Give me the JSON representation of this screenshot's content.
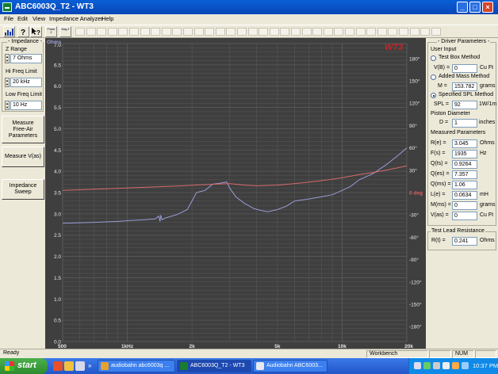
{
  "window": {
    "title": "ABC6003Q_T2 - WT3",
    "btn_minimize": "_",
    "btn_maximize": "□",
    "btn_close": "×"
  },
  "menu": [
    "File",
    "Edit",
    "View",
    "Impedance Analyzer",
    "Help"
  ],
  "toolbar": {
    "icons": [
      "chart-icon",
      "help-icon",
      "context-help-icon"
    ],
    "view_buttons": [
      {
        "label": "Phase Z"
      },
      {
        "label": "Mag Z"
      }
    ]
  },
  "left_panel": {
    "impedance_group_title": "Impedance",
    "z_range_label": "Z Range",
    "z_range_value": "7 Ohms",
    "hi_freq_label": "Hi Freq Limit",
    "hi_freq_value": "20 kHz",
    "low_freq_label": "Low Freq Limit",
    "low_freq_value": "10 Hz",
    "measure_free_air_lines": [
      "Measure",
      "Free-Air",
      "Parameters"
    ],
    "measure_vas_label": "Measure V(as)",
    "impedance_sweep_lines": [
      "Impedance",
      "Sweep"
    ]
  },
  "graph": {
    "logo": "WT3",
    "left_unit": "Ohms",
    "left_axis_ticks": [
      "7.0",
      "6.5",
      "6.0",
      "5.5",
      "5.0",
      "4.5",
      "4.0",
      "3.5",
      "3.0",
      "2.5",
      "2.0",
      "1.5",
      "1.0",
      "0.5",
      "0.0"
    ],
    "right_axis_ticks": [
      "180°",
      "150°",
      "120°",
      "90°",
      "60°",
      "30°",
      "0 deg",
      "-30°",
      "-60°",
      "-90°",
      "-120°",
      "-150°",
      "-180°"
    ],
    "x_axis_ticks": [
      "500",
      "1kHz",
      "2k",
      "5k",
      "10k",
      "20k"
    ],
    "colors": {
      "background": "#3f3f3f",
      "grid": "#5a5a5a",
      "impedance": "#9a9cd8",
      "phase": "#d86a6a"
    }
  },
  "chart_data": {
    "type": "line",
    "x_scale": "log",
    "xlim": [
      500,
      20000
    ],
    "ylim": [
      0,
      7
    ],
    "y2lim": [
      -200,
      200
    ],
    "series": [
      {
        "name": "impedance",
        "axis": "left",
        "x": [
          500,
          700,
          900,
          1000,
          1200,
          1350,
          1400,
          1420,
          1430,
          1450,
          1500,
          1700,
          1900,
          2000,
          2100,
          2300,
          2500,
          2700,
          2900,
          3000,
          3200,
          3500,
          3900,
          4200,
          4500,
          5000,
          5500,
          6000,
          7000,
          8000,
          9000,
          10000,
          11000,
          12000,
          14000,
          16000,
          18000,
          20000
        ],
        "y": [
          2.78,
          2.8,
          2.82,
          2.84,
          2.86,
          2.88,
          2.95,
          2.82,
          2.97,
          2.86,
          2.9,
          2.98,
          3.1,
          3.3,
          3.5,
          3.55,
          3.7,
          3.72,
          3.75,
          3.6,
          3.4,
          3.25,
          3.12,
          3.08,
          3.05,
          3.1,
          3.18,
          3.3,
          3.35,
          3.4,
          3.45,
          3.55,
          3.65,
          3.8,
          3.95,
          4.15,
          4.35,
          4.55
        ]
      },
      {
        "name": "phase",
        "axis": "right",
        "x": [
          500,
          800,
          1200,
          1800,
          2400,
          3000,
          3500,
          4000,
          5000,
          6000,
          7000,
          8000,
          9000,
          10000,
          12000,
          14000,
          16000,
          18000,
          20000
        ],
        "y": [
          3,
          5,
          7,
          9,
          11,
          12,
          10,
          9,
          10,
          12,
          14,
          16,
          18,
          20,
          24,
          27,
          30,
          33,
          36
        ]
      }
    ]
  },
  "right_panel": {
    "driver_title": "Driver Parameters",
    "user_input_label": "User Input",
    "test_box_label": "Test Box Method",
    "vb_label": "V(B) =",
    "vb_value": "0",
    "vb_unit": "Cu Ft",
    "added_mass_label": "Added Mass Method",
    "m_label": "M =",
    "m_value": "153.782",
    "m_unit": "grams",
    "spl_method_label": "Specified SPL Method",
    "spl_label": "SPL =",
    "spl_value": "92",
    "spl_unit": "1W/1m",
    "piston_label": "Piston Diameter",
    "d_label": "D =",
    "d_value": "1",
    "d_unit": "inches",
    "measured_title": "Measured Parameters",
    "params": [
      {
        "label": "R(e) =",
        "value": "3.045",
        "unit": "Ohms"
      },
      {
        "label": "F(s) =",
        "value": "1935",
        "unit": "Hz"
      },
      {
        "label": "Q(ts) =",
        "value": "0.9264",
        "unit": ""
      },
      {
        "label": "Q(es) =",
        "value": "7.357",
        "unit": ""
      },
      {
        "label": "Q(ms) =",
        "value": "1.06",
        "unit": ""
      },
      {
        "label": "L(e) =",
        "value": "0.0634",
        "unit": "mH"
      },
      {
        "label": "M(ms) =",
        "value": "0",
        "unit": "grams"
      },
      {
        "label": "V(as) =",
        "value": "0",
        "unit": "Cu Ft"
      }
    ],
    "lead_title": "Test Lead Resistance",
    "rt_label": "R(t) =",
    "rt_value": "0.241",
    "rt_unit": "Ohms"
  },
  "status": {
    "ready": "Ready",
    "workbench": "Workbench",
    "num": "NUM"
  },
  "taskbar": {
    "start": "start",
    "tasks": [
      {
        "label": "audiobahn abc6003q ..."
      },
      {
        "label": "ABC6003Q_T2 - WT3"
      },
      {
        "label": "Audiobahn ABC6003..."
      }
    ],
    "clock": "10:37 PM"
  }
}
